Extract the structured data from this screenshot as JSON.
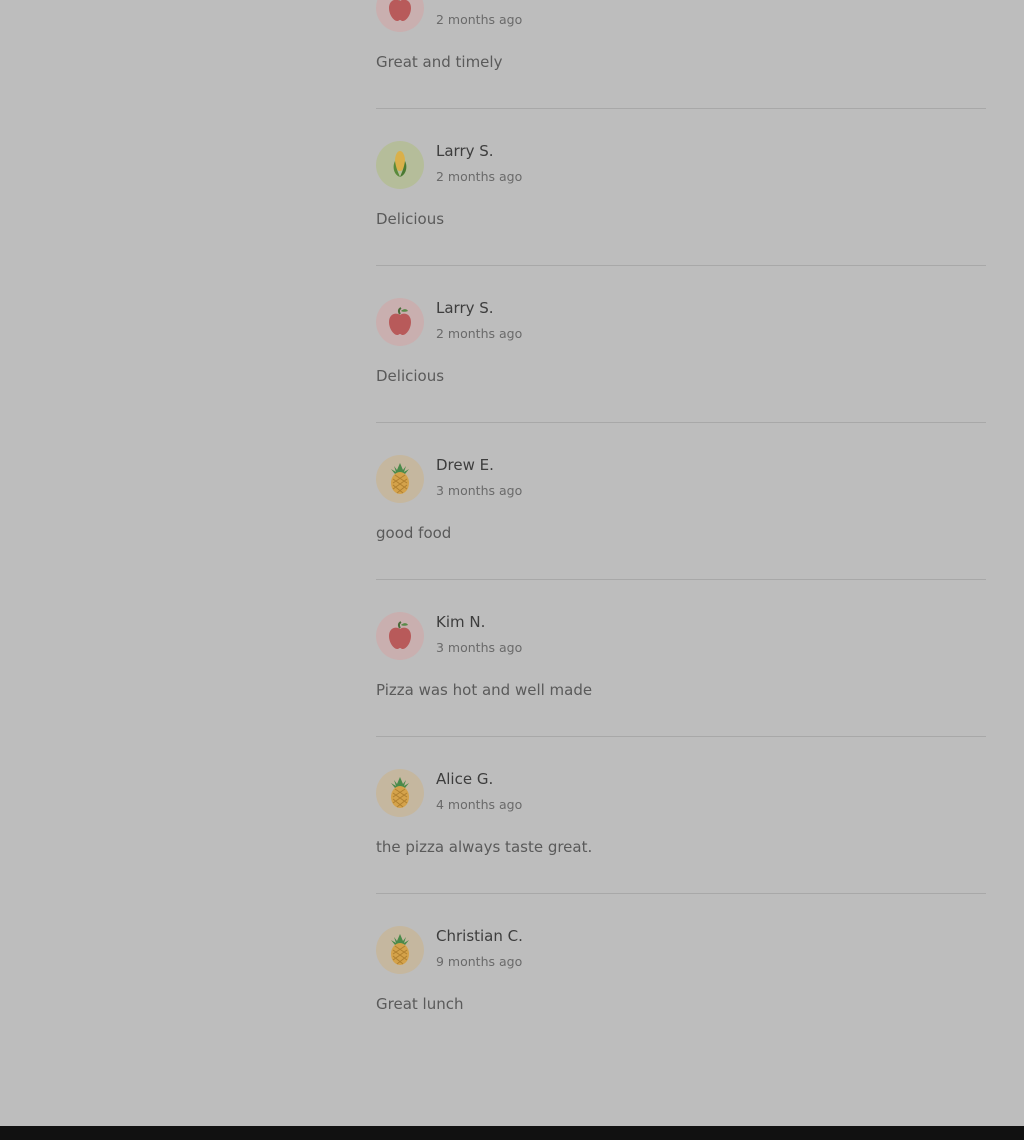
{
  "reviews": [
    {
      "name": "",
      "time": "2 months ago",
      "text": "Great and timely",
      "avatar_icon": "apple-icon"
    },
    {
      "name": "Larry S.",
      "time": "2 months ago",
      "text": "Delicious",
      "avatar_icon": "corn-icon"
    },
    {
      "name": "Larry S.",
      "time": "2 months ago",
      "text": "Delicious",
      "avatar_icon": "apple-icon"
    },
    {
      "name": "Drew E.",
      "time": "3 months ago",
      "text": "good food",
      "avatar_icon": "pineapple-icon"
    },
    {
      "name": "Kim N.",
      "time": "3 months ago",
      "text": "Pizza was hot and well made",
      "avatar_icon": "apple-icon"
    },
    {
      "name": "Alice G.",
      "time": "4 months ago",
      "text": "the pizza always taste great.",
      "avatar_icon": "pineapple-icon"
    },
    {
      "name": "Christian C.",
      "time": "9 months ago",
      "text": "Great lunch",
      "avatar_icon": "pineapple-icon"
    }
  ],
  "colors": {
    "overlay_background": "#bdbdbd",
    "name_text": "#3d3d3d",
    "meta_text": "#6a6a6a",
    "divider": "#a8a8a8"
  }
}
